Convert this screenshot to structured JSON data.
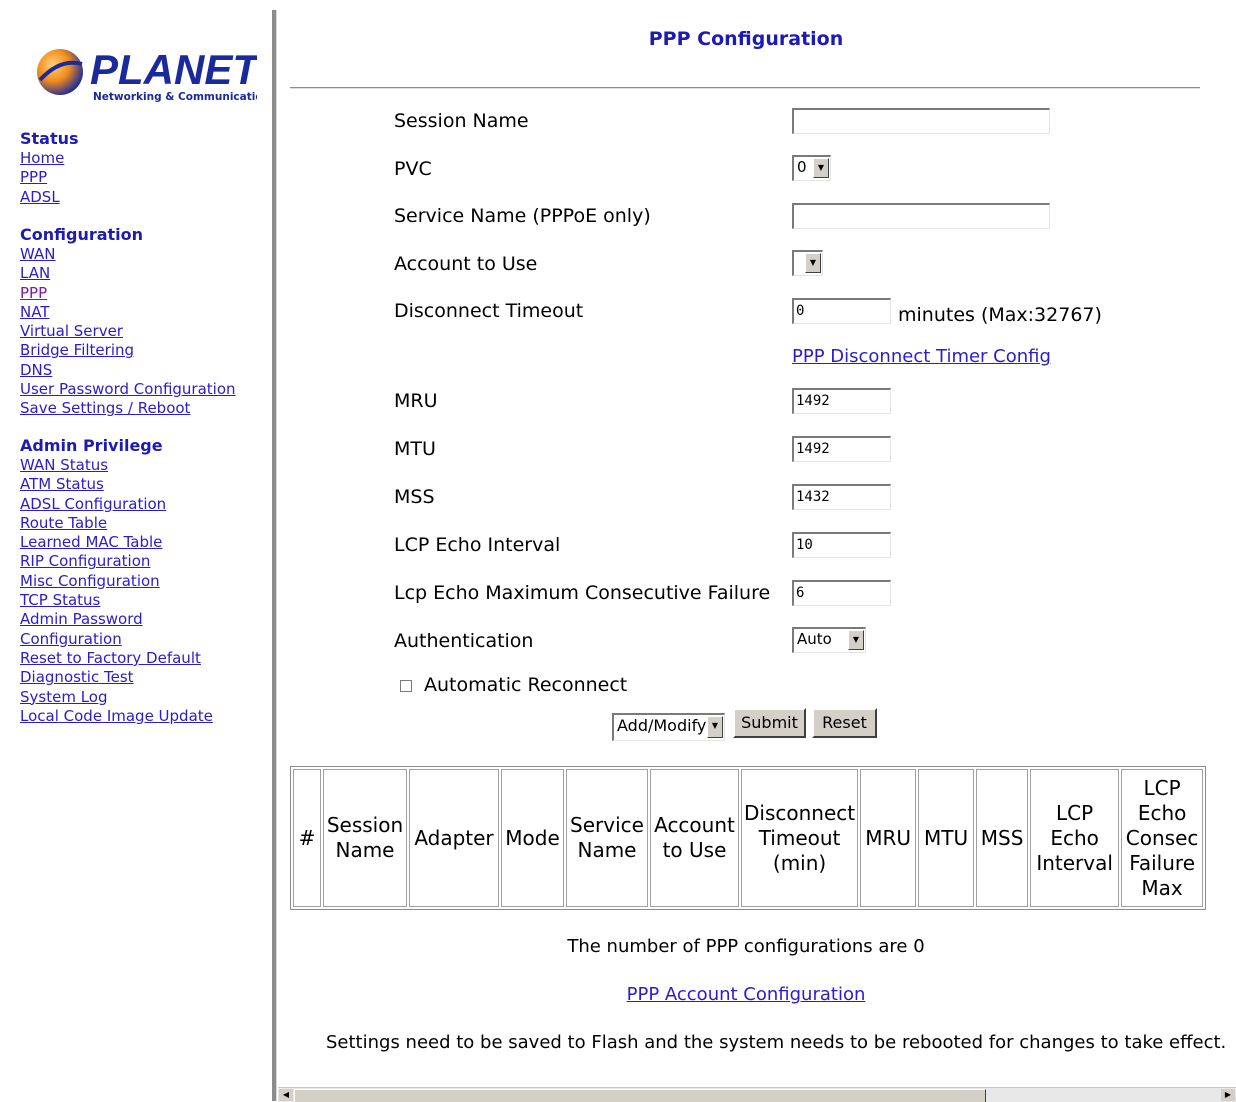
{
  "logo": {
    "brand": "PLANET",
    "tagline": "Networking & Communication"
  },
  "sidebar": {
    "status": {
      "heading": "Status",
      "links": [
        "Home",
        "PPP",
        "ADSL"
      ]
    },
    "configuration": {
      "heading": "Configuration",
      "links": [
        "WAN",
        "LAN",
        "PPP",
        "NAT",
        "Virtual Server",
        "Bridge Filtering",
        "DNS",
        "User Password Configuration",
        "Save Settings / Reboot"
      ]
    },
    "admin": {
      "heading": "Admin Privilege",
      "links": [
        "WAN Status",
        "ATM Status",
        "ADSL Configuration",
        "Route Table",
        "Learned MAC Table",
        "RIP Configuration",
        "Misc Configuration",
        "TCP Status",
        "Admin Password",
        "Configuration",
        "Reset to Factory Default",
        "Diagnostic Test",
        "System Log",
        "Local Code Image Update"
      ]
    }
  },
  "page": {
    "title": "PPP Configuration"
  },
  "form": {
    "session_name": {
      "label": "Session Name",
      "value": ""
    },
    "pvc": {
      "label": "PVC",
      "value": "0"
    },
    "service_name": {
      "label": "Service Name (PPPoE only)",
      "value": ""
    },
    "account": {
      "label": "Account to Use",
      "value": ""
    },
    "disconnect_timeout": {
      "label": "Disconnect Timeout",
      "value": "0",
      "unit_prefix": "minutes (",
      "max": "Max:32767",
      "unit_suffix": ")"
    },
    "timer_link": "PPP Disconnect Timer Config",
    "mru": {
      "label": "MRU",
      "value": "1492"
    },
    "mtu": {
      "label": "MTU",
      "value": "1492"
    },
    "mss": {
      "label": "MSS",
      "value": "1432"
    },
    "lcp_interval": {
      "label": "LCP Echo Interval",
      "value": "10"
    },
    "lcp_failure": {
      "label": "Lcp Echo Maximum Consecutive Failure",
      "value": "6"
    },
    "authentication": {
      "label": "Authentication",
      "value": "Auto"
    },
    "auto_reconnect": {
      "label": "Automatic Reconnect",
      "checked": false
    },
    "action": {
      "value": "Add/Modify"
    },
    "submit_label": "Submit",
    "reset_label": "Reset"
  },
  "table": {
    "columns": [
      "#",
      "Session Name",
      "Adapter",
      "Mode",
      "Service Name",
      "Account to Use",
      "Disconnect Timeout (min)",
      "MRU",
      "MTU",
      "MSS",
      "LCP Echo Interval",
      "LCP Echo Consec Failure Max"
    ]
  },
  "footer": {
    "count_text": "The number of PPP configurations are 0",
    "account_link": "PPP Account Configuration",
    "notice": "Settings need to be saved to Flash and the system needs to be rebooted for changes to take effect."
  },
  "colors": {
    "heading": "#1d1bb3",
    "link": "#2b1bd1",
    "visited_link": "#7a1aa6",
    "logo_blue": "#1a2a9c",
    "logo_orange": "#f28c1b"
  }
}
